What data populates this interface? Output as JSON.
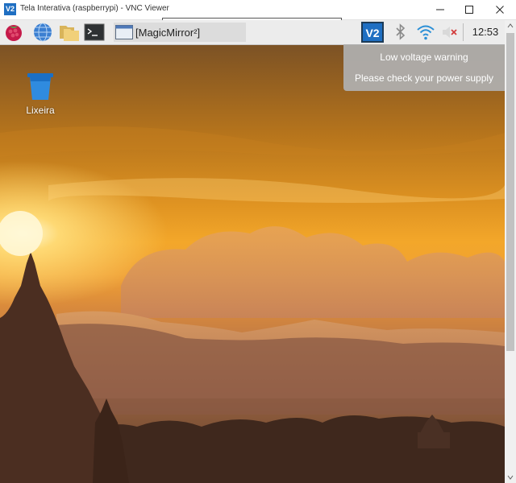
{
  "window": {
    "title": "Tela Interativa (raspberrypi) - VNC Viewer",
    "logo_text": "V2",
    "controls": [
      "minimize",
      "maximize",
      "close"
    ]
  },
  "panel": {
    "launchers": [
      "raspberry-menu",
      "web-browser",
      "file-manager",
      "terminal"
    ],
    "task_button": {
      "label": "[MagicMirror²]"
    },
    "tray": [
      "vnc-server",
      "bluetooth",
      "wifi",
      "volume-muted"
    ],
    "clock": "12:53",
    "colors": {
      "panel_bg": "#ececec",
      "vnc_blue": "#1f6fc2",
      "wifi": "#2a8fd6"
    }
  },
  "notification": {
    "title": "Low voltage warning",
    "body": "Please check your power supply"
  },
  "desktop": {
    "icons": [
      {
        "label": "Lixeira",
        "icon": "trash-icon"
      }
    ],
    "wallpaper": "sunset over temples"
  }
}
